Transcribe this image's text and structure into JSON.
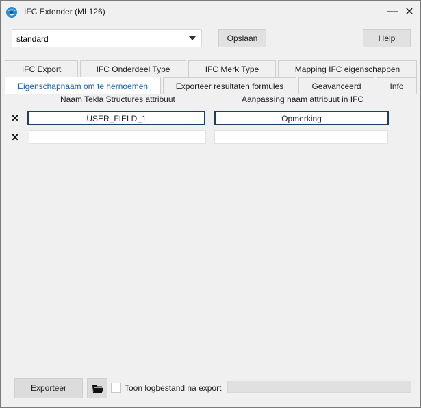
{
  "window": {
    "title": "IFC Extender (ML126)",
    "minimize_glyph": "—",
    "close_glyph": "✕"
  },
  "toolbar": {
    "profile_value": "standard",
    "save_label": "Opslaan",
    "help_label": "Help"
  },
  "tabs_row1": [
    {
      "label": "IFC Export"
    },
    {
      "label": "IFC Onderdeel Type"
    },
    {
      "label": "IFC Merk Type"
    },
    {
      "label": "Mapping IFC eigenschappen"
    }
  ],
  "tabs_row2": [
    {
      "label": "Eigenschapnaam om te hernoemen",
      "active": true
    },
    {
      "label": "Exporteer resultaten formules"
    },
    {
      "label": "Geavanceerd"
    },
    {
      "label": "Info"
    }
  ],
  "grid": {
    "col1_header": "Naam Tekla Structures attribuut",
    "col2_header": "Aanpassing naam attribuut in IFC",
    "delete_glyph": "✕",
    "rows": [
      {
        "tekla_name": "USER_FIELD_1",
        "ifc_name": "Opmerking"
      },
      {
        "tekla_name": "",
        "ifc_name": ""
      }
    ]
  },
  "footer": {
    "export_label": "Exporteer",
    "show_log_label": "Toon logbestand na export",
    "show_log_checked": false,
    "progress_fraction": 0
  },
  "colors": {
    "active_tab_text": "#1c5da8",
    "selected_cell_border": "#1f3f60"
  }
}
